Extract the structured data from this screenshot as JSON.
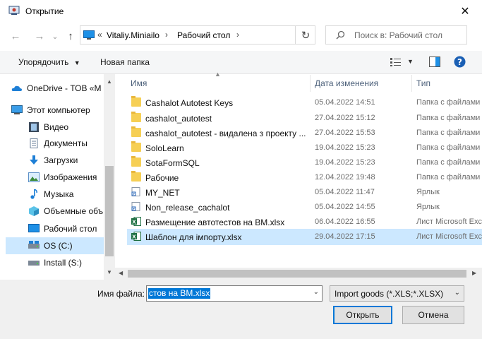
{
  "window": {
    "title": "Открытие",
    "close": "✕"
  },
  "nav": {
    "back": "←",
    "forward": "→",
    "dropdown": "⌄",
    "up": "↑"
  },
  "address": {
    "overflow": "«",
    "segments": [
      "Vitaliy.Miniailo",
      "Рабочий стол"
    ],
    "separator": "›",
    "refresh": "↻"
  },
  "search": {
    "placeholder": "Поиск в: Рабочий стол"
  },
  "toolbar": {
    "organize": "Упорядочить",
    "new_folder": "Новая папка"
  },
  "sidebar": {
    "items": [
      {
        "label": "OneDrive - ТОВ «М",
        "icon": "cloud-icon"
      },
      {
        "label": "Этот компьютер",
        "icon": "computer-icon"
      },
      {
        "label": "Видео",
        "icon": "video-icon"
      },
      {
        "label": "Документы",
        "icon": "document-icon"
      },
      {
        "label": "Загрузки",
        "icon": "download-icon"
      },
      {
        "label": "Изображения",
        "icon": "image-icon"
      },
      {
        "label": "Музыка",
        "icon": "music-icon"
      },
      {
        "label": "Объемные объ",
        "icon": "3d-objects-icon"
      },
      {
        "label": "Рабочий стол",
        "icon": "desktop-icon"
      },
      {
        "label": "OS (C:)",
        "icon": "drive-icon"
      },
      {
        "label": "Install (S:)",
        "icon": "drive-icon"
      }
    ]
  },
  "columns": {
    "name": "Имя",
    "date": "Дата изменения",
    "type": "Тип"
  },
  "files": [
    {
      "name": "Cashalot Autotest Keys",
      "date": "05.04.2022 14:51",
      "type": "Папка с файлами",
      "icon": "folder"
    },
    {
      "name": "cashalot_autotest",
      "date": "27.04.2022 15:12",
      "type": "Папка с файлами",
      "icon": "folder"
    },
    {
      "name": "cashalot_autotest - видалена з проекту ...",
      "date": "27.04.2022 15:53",
      "type": "Папка с файлами",
      "icon": "folder"
    },
    {
      "name": "SoloLearn",
      "date": "19.04.2022 15:23",
      "type": "Папка с файлами",
      "icon": "folder"
    },
    {
      "name": "SotaFormSQL",
      "date": "19.04.2022 15:23",
      "type": "Папка с файлами",
      "icon": "folder"
    },
    {
      "name": "Рабочие",
      "date": "12.04.2022 19:48",
      "type": "Папка с файлами",
      "icon": "folder"
    },
    {
      "name": "MY_NET",
      "date": "05.04.2022 11:47",
      "type": "Ярлык",
      "icon": "shortcut"
    },
    {
      "name": "Non_release_cachalot",
      "date": "05.04.2022 14:55",
      "type": "Ярлык",
      "icon": "shortcut"
    },
    {
      "name": "Размещение автотестов на BM.xlsx",
      "date": "06.04.2022 16:55",
      "type": "Лист Microsoft Excel",
      "icon": "excel"
    },
    {
      "name": "Шаблон для імпорту.xlsx",
      "date": "29.04.2022 17:15",
      "type": "Лист Microsoft Excel",
      "icon": "excel"
    }
  ],
  "footer": {
    "filename_label": "Имя файла:",
    "filename_value": "стов на BM.xlsx",
    "filter_value": "Import goods (*.XLS;*.XLSX)",
    "open_button": "Открыть",
    "cancel_button": "Отмена"
  },
  "colors": {
    "accent": "#0078d7",
    "selection": "#cce8ff",
    "folder": "#f6cf54",
    "excel": "#1d6f42"
  }
}
